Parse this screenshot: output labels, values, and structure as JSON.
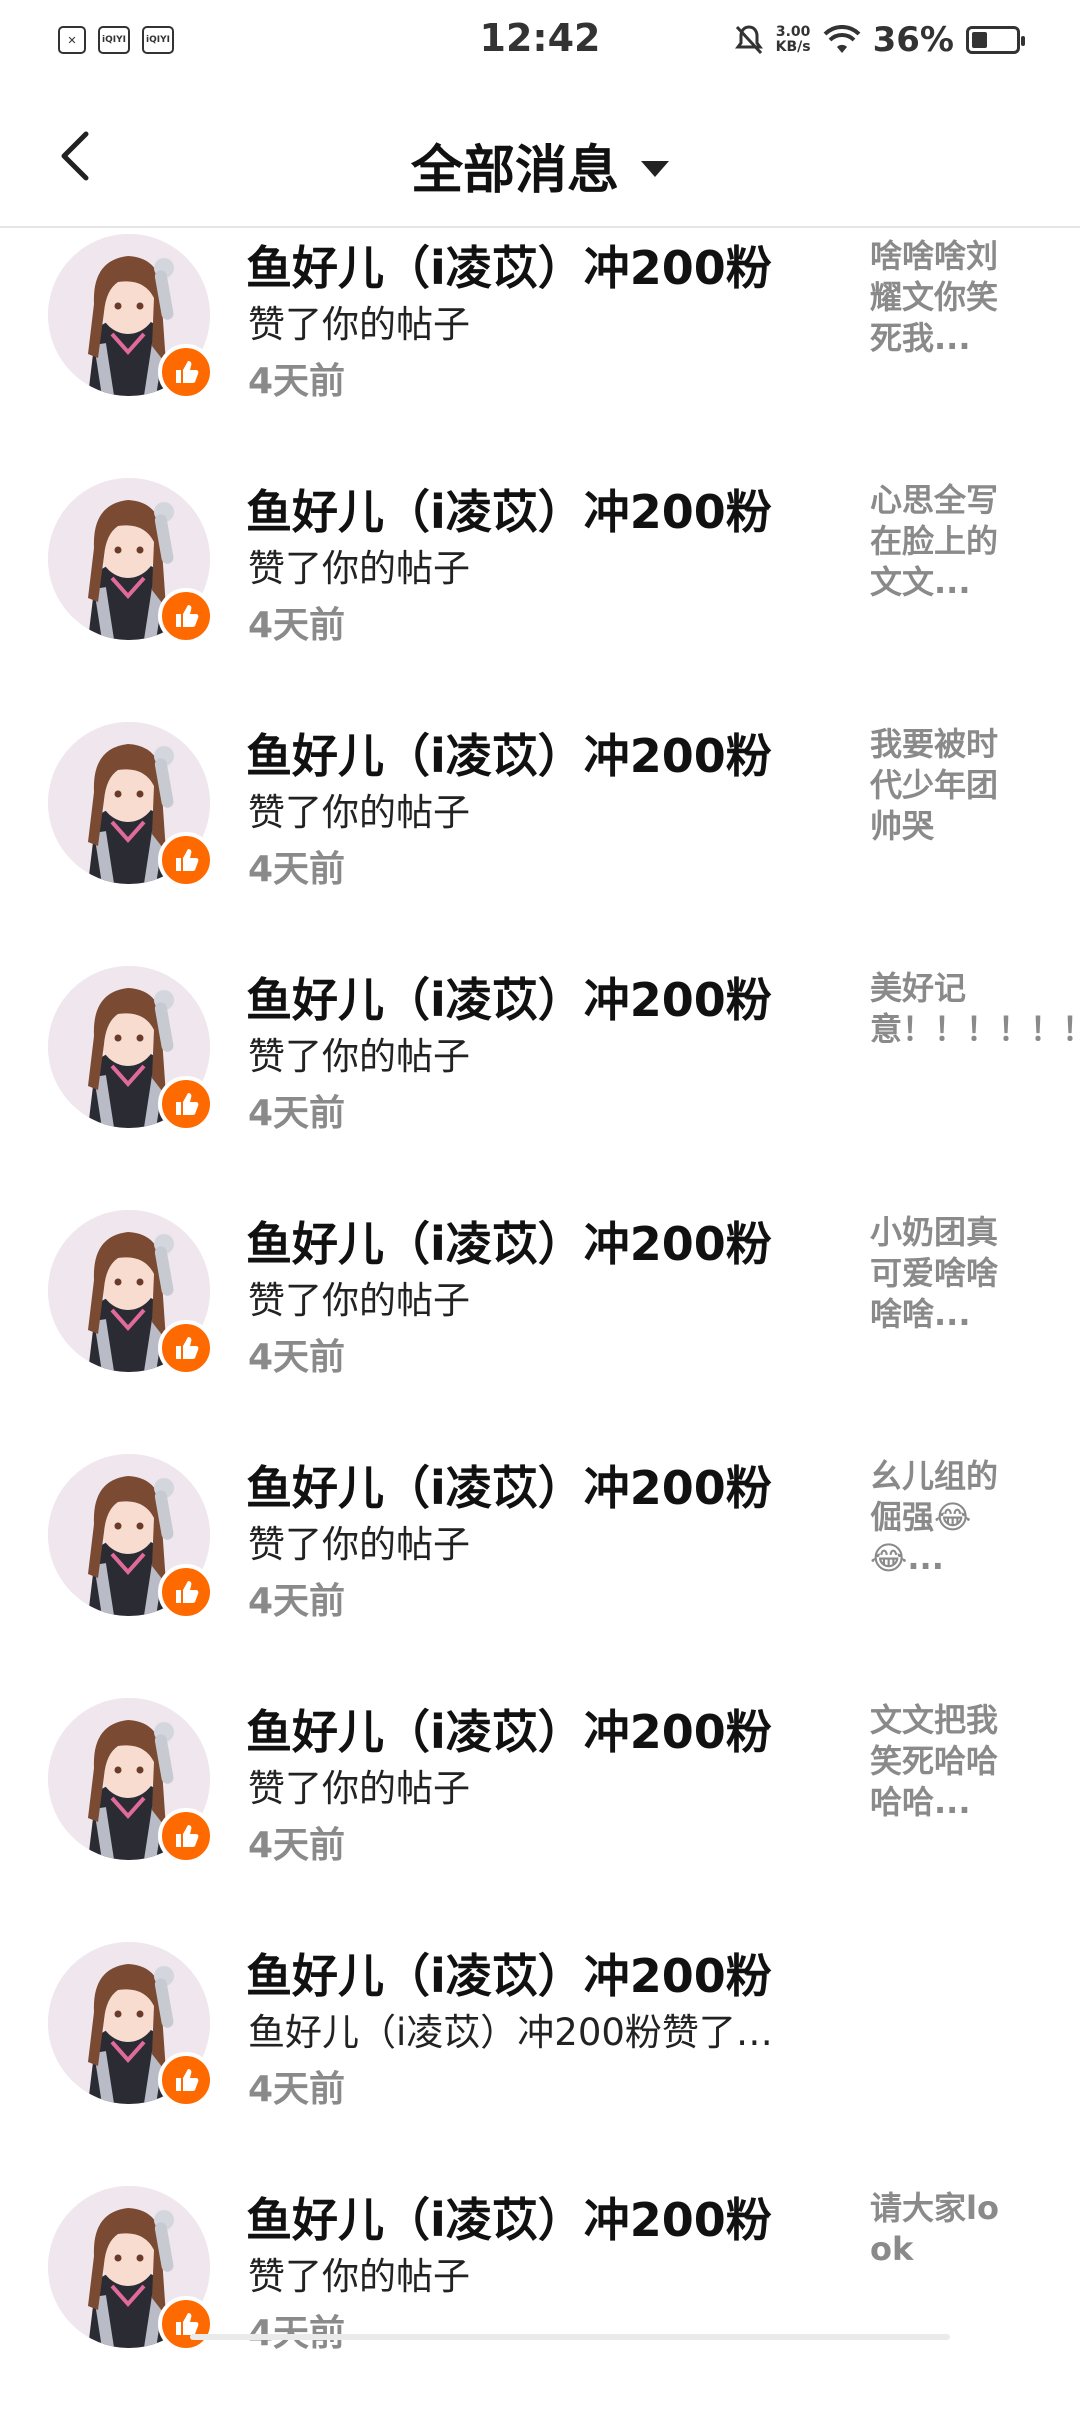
{
  "status_bar": {
    "time": "12:42",
    "left_icons": [
      "sim-off-icon",
      "iqiyi-icon",
      "iqiyi-icon"
    ],
    "left_labels": [
      "✕",
      "iQIYI",
      "iQIYI"
    ],
    "speed_value": "3.00",
    "speed_unit": "KB/s",
    "battery_percent": "36%",
    "battery_level": 0.36
  },
  "header": {
    "title": "全部消息"
  },
  "accent_color": "#ff6a00",
  "messages": [
    {
      "name": "鱼好儿（i凌苡）冲200粉",
      "action": "赞了你的帖子",
      "time": "4天前",
      "preview": "啥啥啥刘耀文你笑死我..."
    },
    {
      "name": "鱼好儿（i凌苡）冲200粉",
      "action": "赞了你的帖子",
      "time": "4天前",
      "preview": "心思全写在脸上的文文..."
    },
    {
      "name": "鱼好儿（i凌苡）冲200粉",
      "action": "赞了你的帖子",
      "time": "4天前",
      "preview": "我要被时代少年团帅哭"
    },
    {
      "name": "鱼好儿（i凌苡）冲200粉",
      "action": "赞了你的帖子",
      "time": "4天前",
      "preview": "美好记意！！！！！！..."
    },
    {
      "name": "鱼好儿（i凌苡）冲200粉",
      "action": "赞了你的帖子",
      "time": "4天前",
      "preview": "小奶团真可爱啥啥啥啥..."
    },
    {
      "name": "鱼好儿（i凌苡）冲200粉",
      "action": "赞了你的帖子",
      "time": "4天前",
      "preview": "幺儿组的倔强😂😂..."
    },
    {
      "name": "鱼好儿（i凌苡）冲200粉",
      "action": "赞了你的帖子",
      "time": "4天前",
      "preview": "文文把我笑死哈哈哈哈..."
    },
    {
      "name": "鱼好儿（i凌苡）冲200粉",
      "action": "鱼好儿（i凌苡）冲200粉赞了…",
      "time": "4天前",
      "preview": ""
    },
    {
      "name": "鱼好儿（i凌苡）冲200粉",
      "action": "赞了你的帖子",
      "time": "4天前",
      "preview": "请大家look"
    }
  ]
}
